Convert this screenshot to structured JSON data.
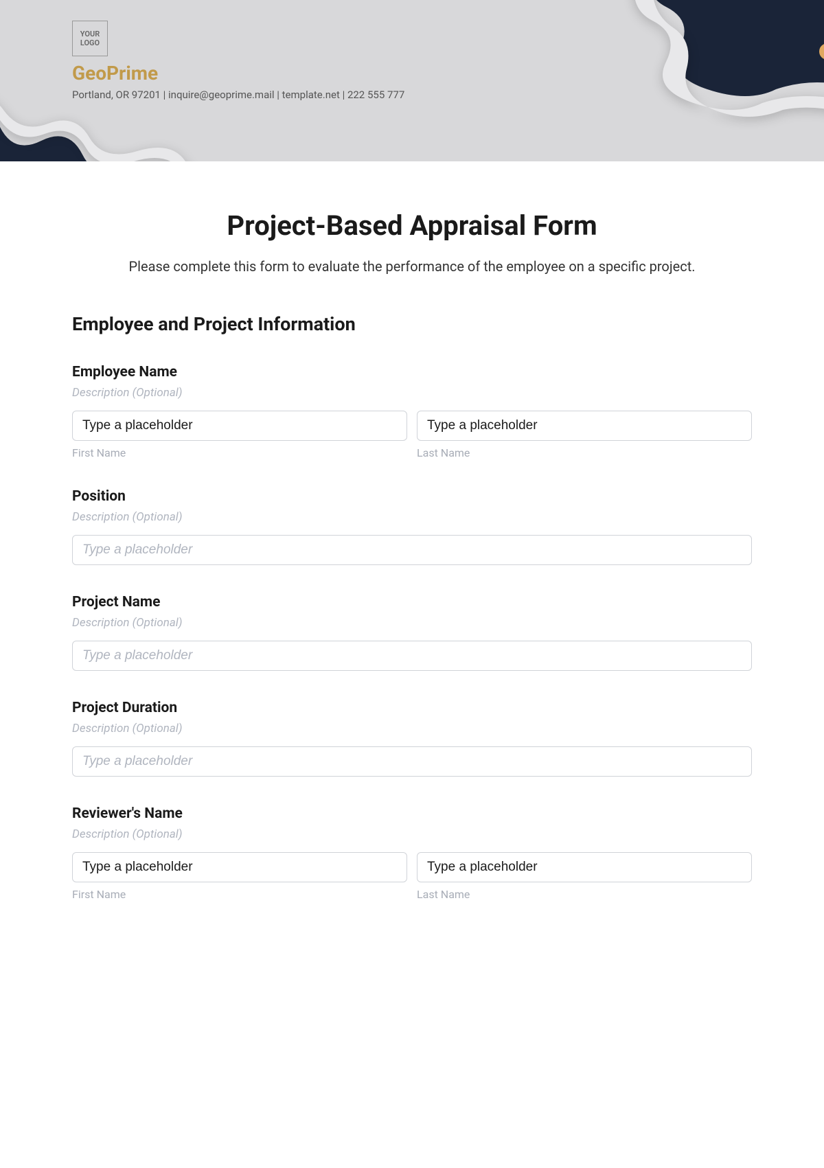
{
  "header": {
    "logo_text": "YOUR LOGO",
    "brand": "GeoPrime",
    "contact": "Portland, OR 97201 | inquire@geoprime.mail | template.net | 222 555 777"
  },
  "form": {
    "title": "Project-Based Appraisal Form",
    "description": "Please complete this form to evaluate the performance of the employee on a specific project.",
    "section_title": "Employee and Project Information",
    "fields": {
      "employee_name": {
        "label": "Employee Name",
        "desc": "Description (Optional)",
        "first_name_value": "Type a placeholder",
        "last_name_value": "Type a placeholder",
        "first_name_sub": "First Name",
        "last_name_sub": "Last Name"
      },
      "position": {
        "label": "Position",
        "desc": "Description (Optional)",
        "placeholder": "Type a placeholder"
      },
      "project_name": {
        "label": "Project Name",
        "desc": "Description (Optional)",
        "placeholder": "Type a placeholder"
      },
      "project_duration": {
        "label": "Project Duration",
        "desc": "Description (Optional)",
        "placeholder": "Type a placeholder"
      },
      "reviewer_name": {
        "label": "Reviewer's Name",
        "desc": "Description (Optional)",
        "first_name_value": "Type a placeholder",
        "last_name_value": "Type a placeholder",
        "first_name_sub": "First Name",
        "last_name_sub": "Last Name"
      }
    }
  }
}
